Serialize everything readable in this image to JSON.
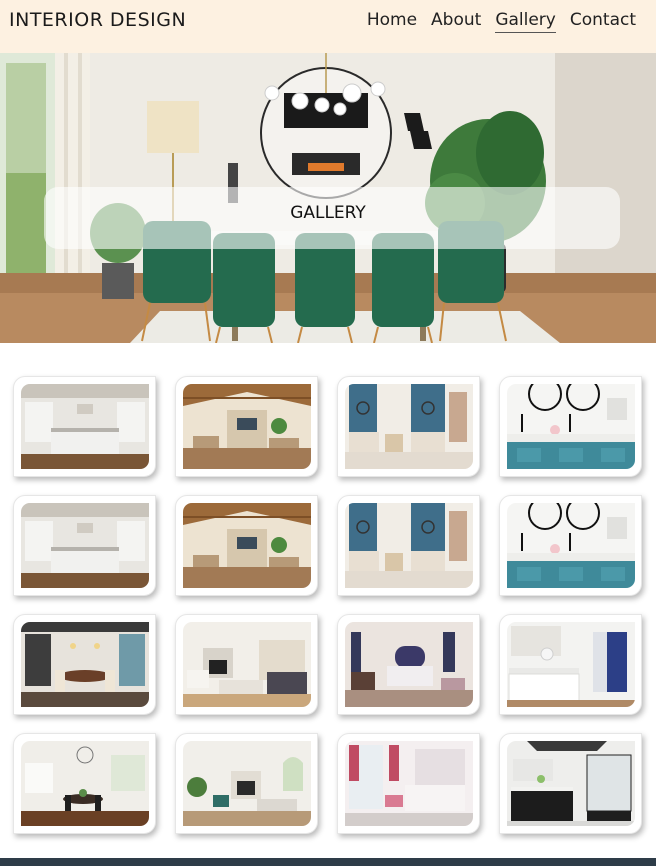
{
  "header": {
    "logo": "INTERIOR DESIGN",
    "nav": [
      "Home",
      "About",
      "Gallery",
      "Contact"
    ],
    "active": "Gallery"
  },
  "hero": {
    "title": "GALLERY"
  },
  "gallery": {
    "images": [
      {
        "scene": "white-kitchen"
      },
      {
        "scene": "beamed-living-room"
      },
      {
        "scene": "blue-wall-bedroom"
      },
      {
        "scene": "bathroom-vanity"
      },
      {
        "scene": "white-kitchen"
      },
      {
        "scene": "beamed-living-room"
      },
      {
        "scene": "blue-wall-bedroom"
      },
      {
        "scene": "bathroom-vanity"
      },
      {
        "scene": "dining-room"
      },
      {
        "scene": "living-room-fireplace"
      },
      {
        "scene": "navy-bedroom"
      },
      {
        "scene": "white-bathroom"
      },
      {
        "scene": "open-dining-kitchen"
      },
      {
        "scene": "fireplace-sitting-room"
      },
      {
        "scene": "pink-bedroom"
      },
      {
        "scene": "dark-vanity-bathroom"
      }
    ]
  },
  "colors": {
    "header_bg": "#fdf1e1",
    "footer": "#2e3c48",
    "accent_green": "#2f6b4f"
  }
}
